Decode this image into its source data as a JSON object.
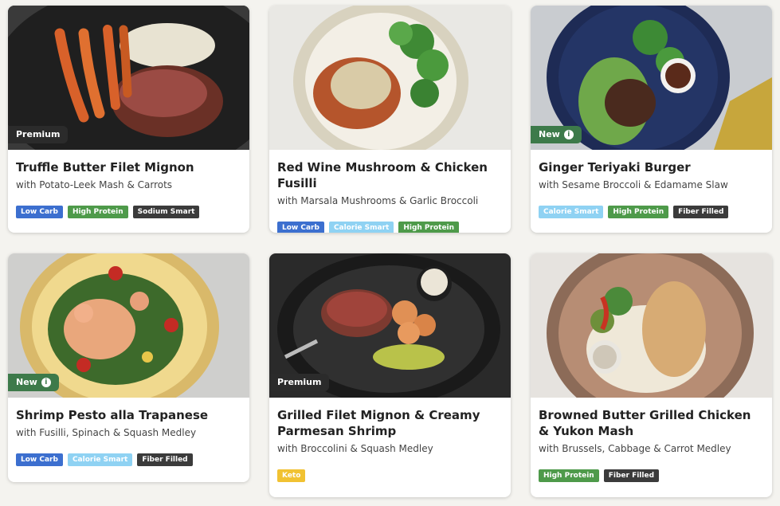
{
  "colors": {
    "low_carb": "#3c6fcf",
    "high_protein": "#4e9a4a",
    "sodium_smart": "#3b3b3b",
    "calorie_smart": "#8fd2f3",
    "fiber_filled": "#3b3b3b",
    "keto": "#f1c232"
  },
  "meals": [
    {
      "tag": "Premium",
      "title": "Truffle Butter Filet Mignon",
      "subtitle": "with Potato-Leek Mash & Carrots",
      "badges": [
        "Low Carb",
        "High Protein",
        "Sodium Smart"
      ]
    },
    {
      "tag": "",
      "title": "Red Wine Mushroom & Chicken Fusilli",
      "subtitle": "with Marsala Mushrooms & Garlic Broccoli",
      "badges": [
        "Low Carb",
        "Calorie Smart",
        "High Protein"
      ]
    },
    {
      "tag": "New",
      "title": "Ginger Teriyaki Burger",
      "subtitle": "with Sesame Broccoli & Edamame Slaw",
      "badges": [
        "Calorie Smart",
        "High Protein",
        "Fiber Filled"
      ]
    },
    {
      "tag": "New",
      "title": "Shrimp Pesto alla Trapanese",
      "subtitle": "with Fusilli, Spinach & Squash Medley",
      "badges": [
        "Low Carb",
        "Calorie Smart",
        "Fiber Filled"
      ]
    },
    {
      "tag": "Premium",
      "title": "Grilled Filet Mignon & Creamy Parmesan Shrimp",
      "subtitle": "with Broccolini & Squash Medley",
      "badges": [
        "Keto"
      ]
    },
    {
      "tag": "",
      "title": "Browned Butter Grilled Chicken & Yukon Mash",
      "subtitle": "with Brussels, Cabbage & Carrot Medley",
      "badges": [
        "High Protein",
        "Fiber Filled"
      ]
    }
  ],
  "info_icon": "info-icon",
  "info_glyph": "i"
}
